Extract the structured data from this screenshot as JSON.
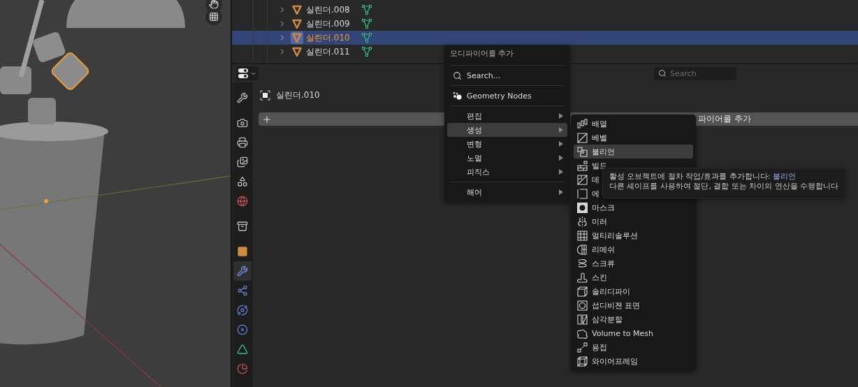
{
  "outliner": {
    "rows": [
      {
        "name": "실린더.008",
        "selected": false
      },
      {
        "name": "실린더.009",
        "selected": false
      },
      {
        "name": "실린더.010",
        "selected": true
      },
      {
        "name": "실린더.011",
        "selected": false
      }
    ]
  },
  "properties": {
    "search": {
      "placeholder": "Search"
    },
    "object_name": "실린더.010",
    "tabs": [
      {
        "kind": "tool",
        "selected": false
      },
      {
        "kind": "render",
        "selected": false
      },
      {
        "kind": "output",
        "selected": false
      },
      {
        "kind": "view_layer",
        "selected": false
      },
      {
        "kind": "scene",
        "selected": false
      },
      {
        "kind": "world",
        "selected": false
      },
      {
        "kind": "collection",
        "selected": false
      },
      {
        "kind": "object",
        "selected": false
      },
      {
        "kind": "modifier",
        "selected": true
      },
      {
        "kind": "particles",
        "selected": false
      },
      {
        "kind": "physics",
        "selected": false
      },
      {
        "kind": "constraints",
        "selected": false
      },
      {
        "kind": "data",
        "selected": false
      },
      {
        "kind": "material",
        "selected": false
      }
    ],
    "add_modifier": {
      "label": "파이어를 추가"
    }
  },
  "menu": {
    "title": "모디파이어를 추가",
    "items": [
      {
        "kind": "separator"
      },
      {
        "kind": "search",
        "label": "Search..."
      },
      {
        "kind": "separator"
      },
      {
        "kind": "nodes",
        "label": "Geometry Nodes"
      },
      {
        "kind": "separator"
      },
      {
        "kind": "submenu",
        "label": "편집",
        "selected": false
      },
      {
        "kind": "submenu",
        "label": "생성",
        "selected": true
      },
      {
        "kind": "submenu",
        "label": "변형",
        "selected": false
      },
      {
        "kind": "submenu",
        "label": "노멀",
        "selected": false
      },
      {
        "kind": "submenu",
        "label": "피직스",
        "selected": false
      },
      {
        "kind": "separator"
      },
      {
        "kind": "submenu",
        "label": "해어",
        "selected": false
      }
    ]
  },
  "submenu": {
    "items": [
      {
        "kind": "array",
        "label": "배열",
        "selected": false
      },
      {
        "kind": "bevel",
        "label": "베벨",
        "selected": false
      },
      {
        "kind": "boolean",
        "label": "불리언",
        "selected": true
      },
      {
        "kind": "build",
        "label": "빌드",
        "selected": false
      },
      {
        "kind": "decimate",
        "label": "데",
        "selected": false
      },
      {
        "kind": "edge_split",
        "label": "에",
        "selected": false
      },
      {
        "kind": "mask",
        "label": "마스크",
        "selected": false
      },
      {
        "kind": "mirror",
        "label": "미러",
        "selected": false
      },
      {
        "kind": "multires",
        "label": "멀티리솔루션",
        "selected": false
      },
      {
        "kind": "remesh",
        "label": "리메쉬",
        "selected": false
      },
      {
        "kind": "screw",
        "label": "스크류",
        "selected": false
      },
      {
        "kind": "skin",
        "label": "스킨",
        "selected": false
      },
      {
        "kind": "solidify",
        "label": "솔리디파이",
        "selected": false
      },
      {
        "kind": "subsurf",
        "label": "섭디비젼 표면",
        "selected": false
      },
      {
        "kind": "triangulate",
        "label": "삼각분할",
        "selected": false
      },
      {
        "kind": "volume",
        "label": "Volume to Mesh",
        "selected": false
      },
      {
        "kind": "weld",
        "label": "용접",
        "selected": false
      },
      {
        "kind": "wireframe",
        "label": "와이어프레임",
        "selected": false
      }
    ]
  },
  "tooltip": {
    "description": "활성 오브젝트에 절차 작업/효과를 추가합니다:",
    "name": "불리언",
    "detail": "다른 셰이프를 사용하여 절단, 결합 또는 차이의 연산을 수행합니다"
  }
}
